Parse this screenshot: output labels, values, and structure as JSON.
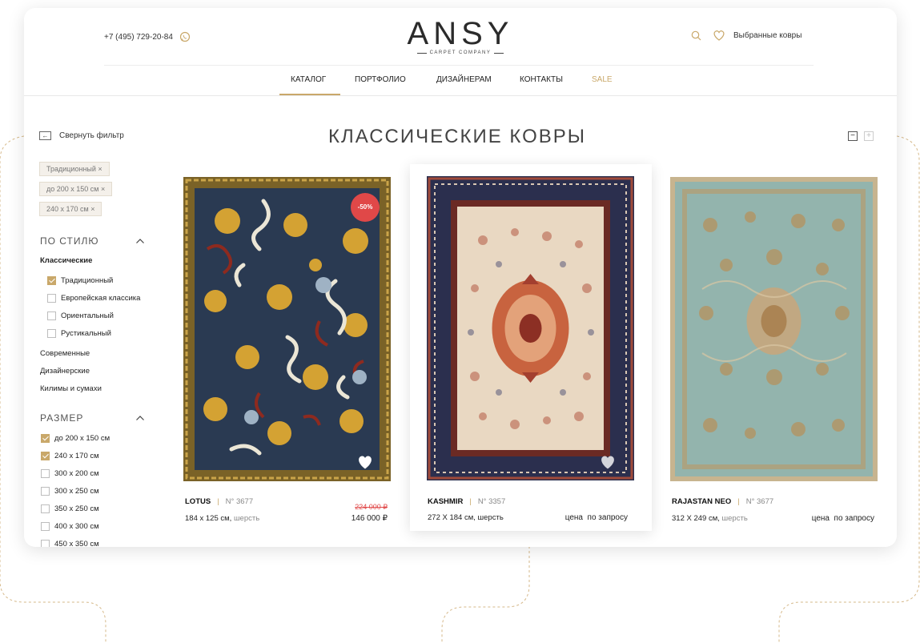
{
  "header": {
    "phone": "+7 (495) 729-20-84",
    "logo": "ANSY",
    "logo_sub": "CARPET COMPANY",
    "favorites_label": "Выбранные ковры"
  },
  "nav": {
    "items": [
      "КАТАЛОГ",
      "ПОРТФОЛИО",
      "ДИЗАЙНЕРАМ",
      "КОНТАКТЫ",
      "SALE"
    ],
    "active": "КАТАЛОГ"
  },
  "sidebar": {
    "collapse_label": "Свернуть фильтр",
    "active_tags": [
      "Традиционный ×",
      "до 200 x 150 см ×",
      "240 x 170 см ×"
    ],
    "style_section": {
      "title": "ПО СТИЛЮ",
      "group": "Классические",
      "options": [
        {
          "label": "Традиционный",
          "checked": true
        },
        {
          "label": "Европейская классика",
          "checked": false
        },
        {
          "label": "Ориентальный",
          "checked": false
        },
        {
          "label": "Рустикальный",
          "checked": false
        }
      ],
      "other_groups": [
        "Современные",
        "Дизайнерские",
        "Килимы и сумахи"
      ]
    },
    "size_section": {
      "title": "РАЗМЕР",
      "options": [
        {
          "label": "до 200 x 150 см",
          "checked": true
        },
        {
          "label": "240 x 170 см",
          "checked": true
        },
        {
          "label": "300 x 200 см",
          "checked": false
        },
        {
          "label": "300 x 250 см",
          "checked": false
        },
        {
          "label": "350 x 250 см",
          "checked": false
        },
        {
          "label": "400 x 300 см",
          "checked": false
        },
        {
          "label": "450 x 350 см",
          "checked": false
        }
      ]
    }
  },
  "main": {
    "title": "КЛАССИЧЕСКИЕ КОВРЫ",
    "view_buttons": [
      "−",
      "+"
    ],
    "products": [
      {
        "name": "LOTUS",
        "number": "N° 3677",
        "size": "184 x 125 см,",
        "material": "шерсть",
        "old_price": "224 000 ₽",
        "price": "146 000 ₽",
        "badge": "-50%"
      },
      {
        "name": "KASHMIR",
        "number": "N° 3357",
        "size": "272 X 184 см,",
        "material": "шерсть",
        "price": "цена  по запросу"
      },
      {
        "name": "RAJASTAN NEO",
        "number": "N° 3677",
        "size": "312 X 249 см,",
        "material": "шерсть",
        "price": "цена  по запросу"
      }
    ]
  },
  "colors": {
    "accent": "#c9a86a",
    "sale": "#e04848"
  }
}
